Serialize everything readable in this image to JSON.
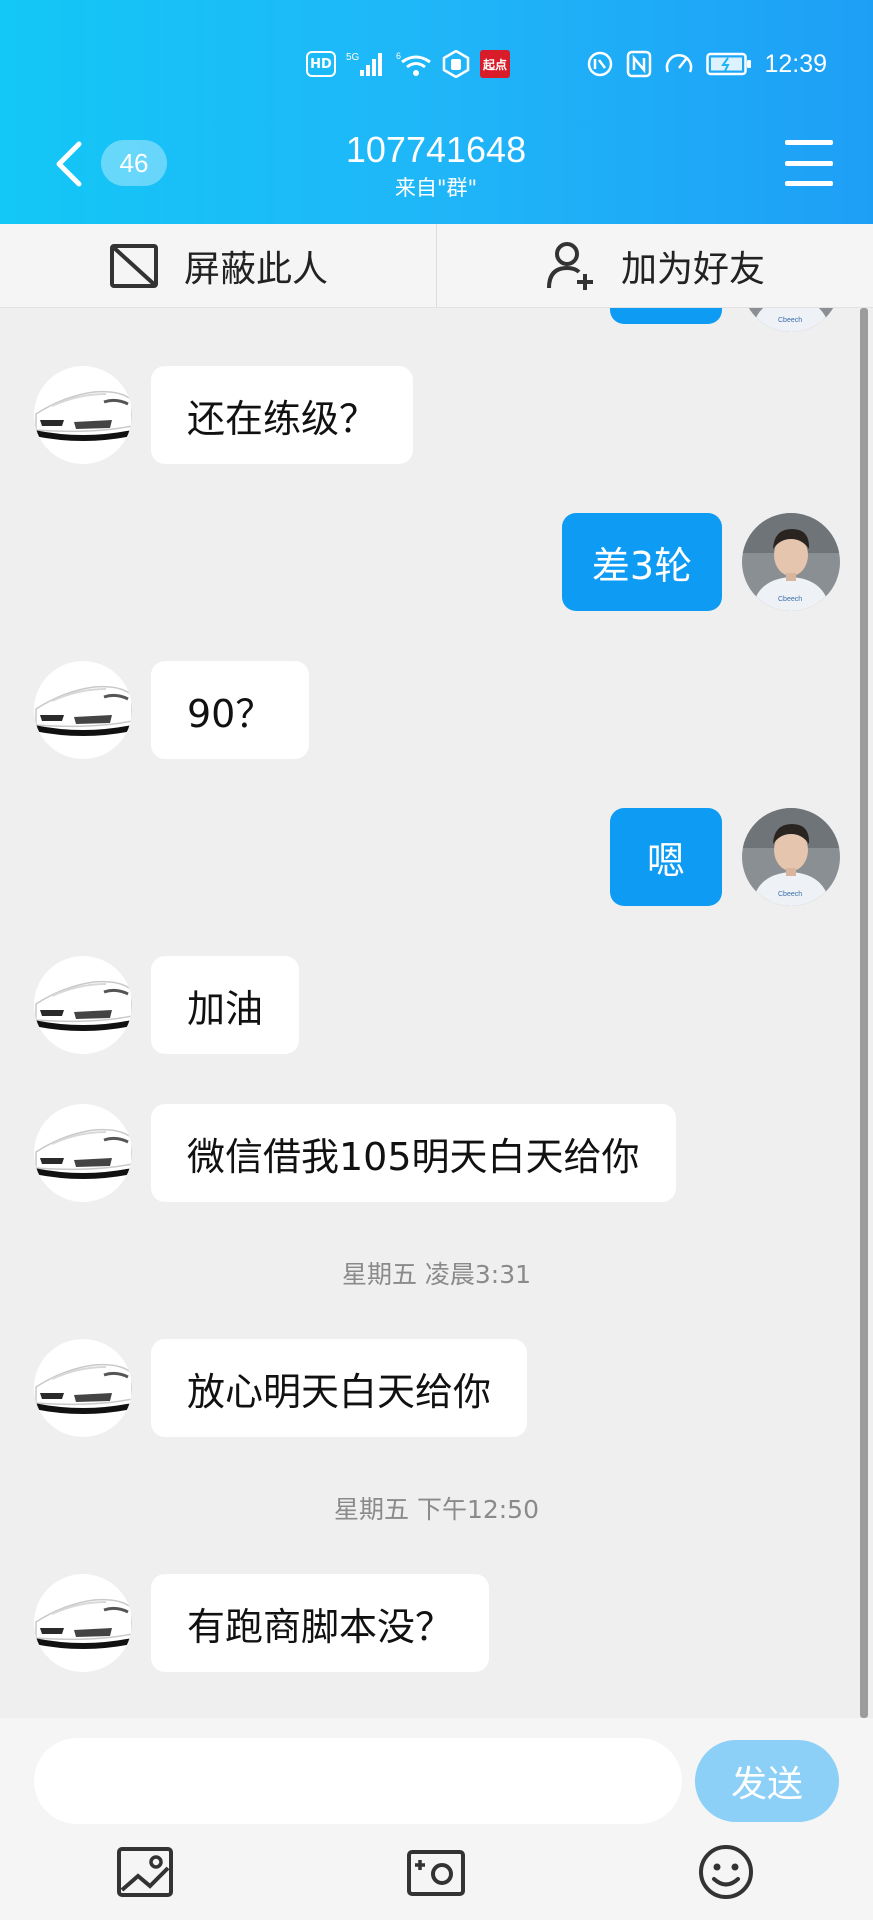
{
  "status_bar": {
    "hd": "HD",
    "signal": "5G",
    "wifi": "6",
    "qidian": "起点",
    "time": "12:39"
  },
  "header": {
    "unread_count": "46",
    "title": "107741648",
    "subtitle": "来自\"群\"",
    "back_icon": "chevron-left-icon",
    "menu_icon": "hamburger-menu-icon"
  },
  "actions": {
    "block": "屏蔽此人",
    "add_friend": "加为好友"
  },
  "messages": [
    {
      "side": "in",
      "text": "还在练级？"
    },
    {
      "side": "out",
      "text": "差3轮"
    },
    {
      "side": "in",
      "text": "90？"
    },
    {
      "side": "out",
      "text": "嗯"
    },
    {
      "side": "in",
      "text": "加油"
    },
    {
      "side": "in",
      "text": "微信借我105明天白天给你"
    },
    {
      "side": "in",
      "text": "放心明天白天给你"
    },
    {
      "side": "in",
      "text": "有跑商脚本没？"
    }
  ],
  "timestamps": [
    "星期五 凌晨3:31",
    "星期五 下午12:50"
  ],
  "composer": {
    "input_value": "",
    "send": "发送"
  },
  "colors": {
    "header": "#1fb6f8",
    "outgoing_bubble": "#0e9bf3",
    "send_button": "#8ccff7",
    "background": "#efefef"
  }
}
